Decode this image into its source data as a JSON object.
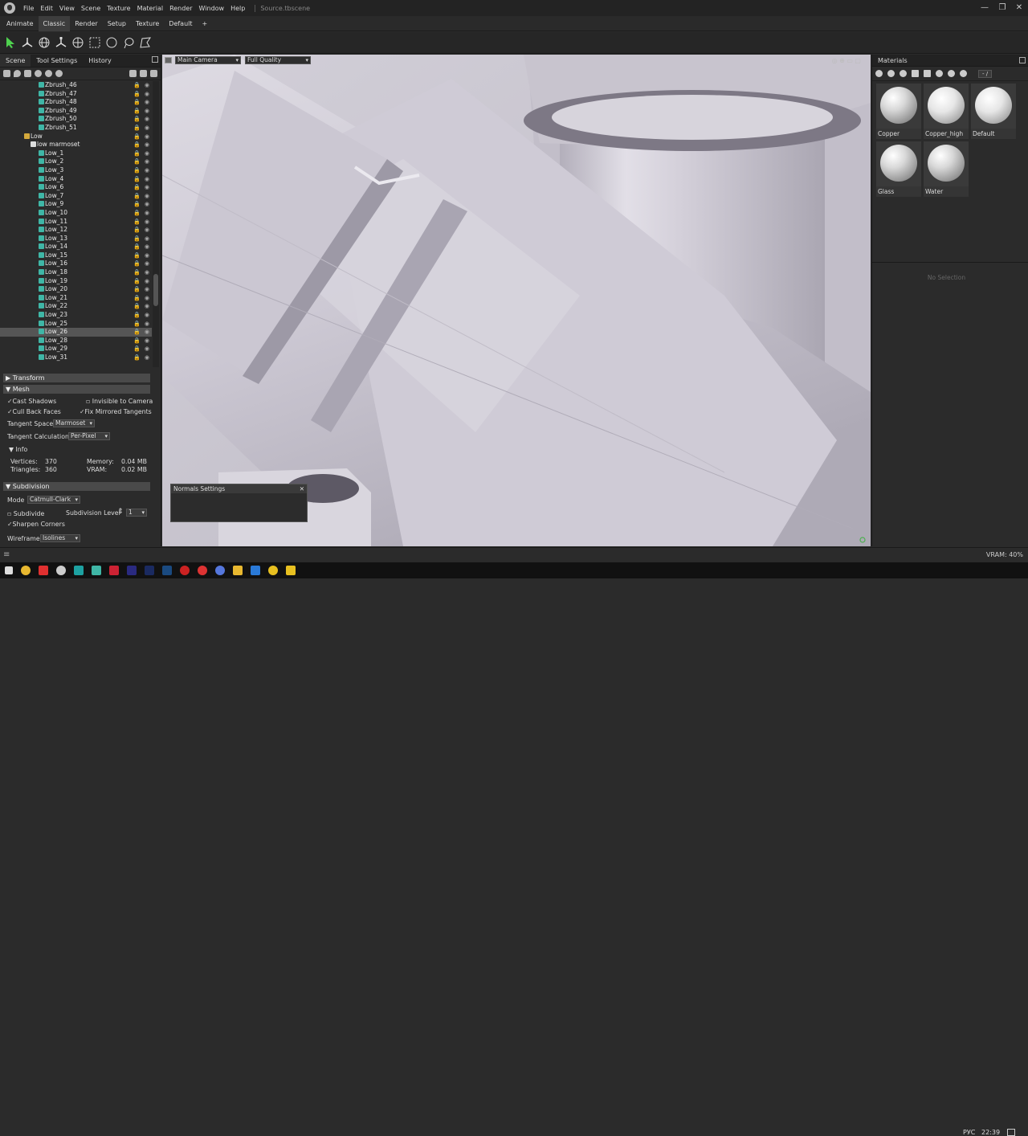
{
  "menubar": {
    "items": [
      "File",
      "Edit",
      "View",
      "Scene",
      "Texture",
      "Material",
      "Render",
      "Window",
      "Help"
    ],
    "source": "Source.tbscene"
  },
  "workspace_tabs": [
    "Animate",
    "Classic",
    "Render",
    "Setup",
    "Texture",
    "Default",
    "+"
  ],
  "active_workspace": "Classic",
  "left_tabs": [
    "Scene",
    "Tool Settings",
    "History"
  ],
  "tree": [
    {
      "label": "Zbrush_46",
      "indent": 48,
      "icon": "mesh"
    },
    {
      "label": "Zbrush_47",
      "indent": 48,
      "icon": "mesh"
    },
    {
      "label": "Zbrush_48",
      "indent": 48,
      "icon": "mesh"
    },
    {
      "label": "Zbrush_49",
      "indent": 48,
      "icon": "mesh"
    },
    {
      "label": "Zbrush_50",
      "indent": 48,
      "icon": "mesh"
    },
    {
      "label": "Zbrush_51",
      "indent": 48,
      "icon": "mesh"
    },
    {
      "label": "Low",
      "indent": 30,
      "icon": "group"
    },
    {
      "label": "low marmoset",
      "indent": 38,
      "icon": "file"
    },
    {
      "label": "Low_1",
      "indent": 48,
      "icon": "mesh"
    },
    {
      "label": "Low_2",
      "indent": 48,
      "icon": "mesh"
    },
    {
      "label": "Low_3",
      "indent": 48,
      "icon": "mesh"
    },
    {
      "label": "Low_4",
      "indent": 48,
      "icon": "mesh"
    },
    {
      "label": "Low_6",
      "indent": 48,
      "icon": "mesh"
    },
    {
      "label": "Low_7",
      "indent": 48,
      "icon": "mesh"
    },
    {
      "label": "Low_9",
      "indent": 48,
      "icon": "mesh"
    },
    {
      "label": "Low_10",
      "indent": 48,
      "icon": "mesh"
    },
    {
      "label": "Low_11",
      "indent": 48,
      "icon": "mesh"
    },
    {
      "label": "Low_12",
      "indent": 48,
      "icon": "mesh"
    },
    {
      "label": "Low_13",
      "indent": 48,
      "icon": "mesh"
    },
    {
      "label": "Low_14",
      "indent": 48,
      "icon": "mesh"
    },
    {
      "label": "Low_15",
      "indent": 48,
      "icon": "mesh"
    },
    {
      "label": "Low_16",
      "indent": 48,
      "icon": "mesh"
    },
    {
      "label": "Low_18",
      "indent": 48,
      "icon": "mesh"
    },
    {
      "label": "Low_19",
      "indent": 48,
      "icon": "mesh"
    },
    {
      "label": "Low_20",
      "indent": 48,
      "icon": "mesh"
    },
    {
      "label": "Low_21",
      "indent": 48,
      "icon": "mesh"
    },
    {
      "label": "Low_22",
      "indent": 48,
      "icon": "mesh"
    },
    {
      "label": "Low_23",
      "indent": 48,
      "icon": "mesh"
    },
    {
      "label": "Low_25",
      "indent": 48,
      "icon": "mesh"
    },
    {
      "label": "Low_26",
      "indent": 48,
      "icon": "mesh",
      "selected": true
    },
    {
      "label": "Low_28",
      "indent": 48,
      "icon": "mesh"
    },
    {
      "label": "Low_29",
      "indent": 48,
      "icon": "mesh"
    },
    {
      "label": "Low_31",
      "indent": 48,
      "icon": "mesh"
    }
  ],
  "props": {
    "transform": "Transform",
    "mesh": "Mesh",
    "cast_shadows": "Cast Shadows",
    "invisible_to_camera": "Invisible to Camera",
    "cull_back_faces": "Cull Back Faces",
    "fix_mirrored_tangents": "Fix Mirrored Tangents",
    "tangent_space_label": "Tangent Space",
    "tangent_space_value": "Marmoset",
    "tangent_calc_label": "Tangent Calculation",
    "tangent_calc_value": "Per-Pixel",
    "info": "Info",
    "vertices_label": "Vertices:",
    "vertices_value": "370",
    "triangles_label": "Triangles:",
    "triangles_value": "360",
    "memory_label": "Memory:",
    "memory_value": "0.04 MB",
    "vram_label": "VRAM:",
    "vram_value": "0.02 MB",
    "subdivision": "Subdivision",
    "mode_label": "Mode",
    "mode_value": "Catmull-Clark",
    "subdivide": "Subdivide",
    "subdiv_level_label": "Subdivision Level",
    "subdiv_level_value": "1",
    "sharpen_corners": "Sharpen Corners",
    "wireframe_label": "Wireframe",
    "wireframe_value": "Isolines"
  },
  "viewport": {
    "camera": "Main Camera",
    "quality": "Full Quality"
  },
  "normals_settings": "Normals Settings",
  "materials": {
    "tab": "Materials",
    "zoom": "- /",
    "items": [
      {
        "name": "Copper",
        "style": "rough"
      },
      {
        "name": "Copper_high",
        "style": "smooth"
      },
      {
        "name": "Default",
        "style": "smooth"
      },
      {
        "name": "Glass",
        "style": "rough"
      },
      {
        "name": "Water",
        "style": "rough"
      }
    ],
    "no_selection": "No Selection"
  },
  "status": {
    "vram": "VRAM: 40%",
    "lang": "РУС",
    "time": "22:39"
  }
}
